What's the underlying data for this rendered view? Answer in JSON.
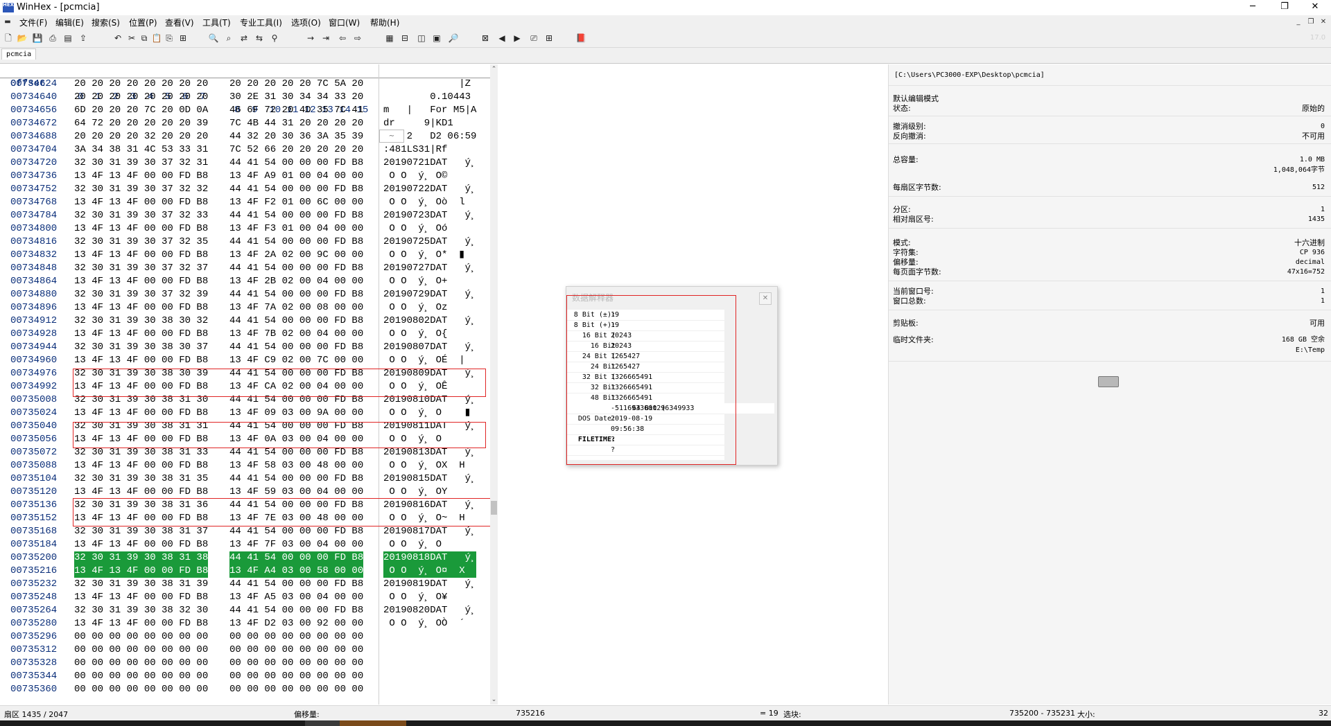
{
  "window": {
    "title": "WinHex - [pcmcia]",
    "app_icon_text": "HEX"
  },
  "menu": [
    "文件(F)",
    "编辑(E)",
    "搜索(S)",
    "位置(P)",
    "查看(V)",
    "工具(T)",
    "专业工具(I)",
    "选项(O)",
    "窗口(W)",
    "帮助(H)"
  ],
  "tab": {
    "label": "pcmcia"
  },
  "hex_header": {
    "offset": "Offset",
    "cols1": "0  1  2  3  4  5  6  7",
    "cols2": "8  9  10 11 12 13 14 15"
  },
  "rows": [
    {
      "off": "00734624",
      "b1": "20 20 20 20 20 20 20 20",
      "b2": "20 20 20 20 20 7C 5A 20",
      "t": "             |Z "
    },
    {
      "off": "00734640",
      "b1": "20 20 20 20 20 20 20 20",
      "b2": "30 2E 31 30 34 34 33 20",
      "t": "        0.10443 "
    },
    {
      "off": "00734656",
      "b1": "6D 20 20 20 7C 20 0D 0A",
      "b2": "46 6F 72 20 4D 35 7C 41",
      "t": "m   |   For M5|A"
    },
    {
      "off": "00734672",
      "b1": "64 72 20 20 20 20 20 39",
      "b2": "7C 4B 44 31 20 20 20 20",
      "t": "dr     9|KD1    "
    },
    {
      "off": "00734688",
      "b1": "20 20 20 20 32 20 20 20",
      "b2": "44 32 20 30 36 3A 35 39",
      "t": "    2   D2 06:59"
    },
    {
      "off": "00734704",
      "b1": "3A 34 38 31 4C 53 33 31",
      "b2": "7C 52 66 20 20 20 20 20",
      "t": ":481LS31|Rf     "
    },
    {
      "off": "00734720",
      "b1": "32 30 31 39 30 37 32 31",
      "b2": "44 41 54 00 00 00 FD B8",
      "t": "20190721DAT   ý¸"
    },
    {
      "off": "00734736",
      "b1": "13 4F 13 4F 00 00 FD B8",
      "b2": "13 4F A9 01 00 04 00 00",
      "t": " O O  ý¸ O©     "
    },
    {
      "off": "00734752",
      "b1": "32 30 31 39 30 37 32 32",
      "b2": "44 41 54 00 00 00 FD B8",
      "t": "20190722DAT   ý¸"
    },
    {
      "off": "00734768",
      "b1": "13 4F 13 4F 00 00 FD B8",
      "b2": "13 4F F2 01 00 6C 00 00",
      "t": " O O  ý¸ Oò  l  "
    },
    {
      "off": "00734784",
      "b1": "32 30 31 39 30 37 32 33",
      "b2": "44 41 54 00 00 00 FD B8",
      "t": "20190723DAT   ý¸"
    },
    {
      "off": "00734800",
      "b1": "13 4F 13 4F 00 00 FD B8",
      "b2": "13 4F F3 01 00 04 00 00",
      "t": " O O  ý¸ Oó     "
    },
    {
      "off": "00734816",
      "b1": "32 30 31 39 30 37 32 35",
      "b2": "44 41 54 00 00 00 FD B8",
      "t": "20190725DAT   ý¸"
    },
    {
      "off": "00734832",
      "b1": "13 4F 13 4F 00 00 FD B8",
      "b2": "13 4F 2A 02 00 9C 00 00",
      "t": " O O  ý¸ O*  ▮  "
    },
    {
      "off": "00734848",
      "b1": "32 30 31 39 30 37 32 37",
      "b2": "44 41 54 00 00 00 FD B8",
      "t": "20190727DAT   ý¸"
    },
    {
      "off": "00734864",
      "b1": "13 4F 13 4F 00 00 FD B8",
      "b2": "13 4F 2B 02 00 04 00 00",
      "t": " O O  ý¸ O+     "
    },
    {
      "off": "00734880",
      "b1": "32 30 31 39 30 37 32 39",
      "b2": "44 41 54 00 00 00 FD B8",
      "t": "20190729DAT   ý¸"
    },
    {
      "off": "00734896",
      "b1": "13 4F 13 4F 00 00 FD B8",
      "b2": "13 4F 7A 02 00 08 00 00",
      "t": " O O  ý¸ Oz     "
    },
    {
      "off": "00734912",
      "b1": "32 30 31 39 30 38 30 32",
      "b2": "44 41 54 00 00 00 FD B8",
      "t": "20190802DAT   ý¸"
    },
    {
      "off": "00734928",
      "b1": "13 4F 13 4F 00 00 FD B8",
      "b2": "13 4F 7B 02 00 04 00 00",
      "t": " O O  ý¸ O{     "
    },
    {
      "off": "00734944",
      "b1": "32 30 31 39 30 38 30 37",
      "b2": "44 41 54 00 00 00 FD B8",
      "t": "20190807DAT   ý¸"
    },
    {
      "off": "00734960",
      "b1": "13 4F 13 4F 00 00 FD B8",
      "b2": "13 4F C9 02 00 7C 00 00",
      "t": " O O  ý¸ OÉ  |  "
    },
    {
      "off": "00734976",
      "b1": "32 30 31 39 30 38 30 39",
      "b2": "44 41 54 00 00 00 FD B8",
      "t": "20190809DAT   ý¸"
    },
    {
      "off": "00734992",
      "b1": "13 4F 13 4F 00 00 FD B8",
      "b2": "13 4F CA 02 00 04 00 00",
      "t": " O O  ý¸ OÊ     "
    },
    {
      "off": "00735008",
      "b1": "32 30 31 39 30 38 31 30",
      "b2": "44 41 54 00 00 00 FD B8",
      "t": "20190810DAT   ý¸"
    },
    {
      "off": "00735024",
      "b1": "13 4F 13 4F 00 00 FD B8",
      "b2": "13 4F 09 03 00 9A 00 00",
      "t": " O O  ý¸ O    ▮  "
    },
    {
      "off": "00735040",
      "b1": "32 30 31 39 30 38 31 31",
      "b2": "44 41 54 00 00 00 FD B8",
      "t": "20190811DAT   ý¸"
    },
    {
      "off": "00735056",
      "b1": "13 4F 13 4F 00 00 FD B8",
      "b2": "13 4F 0A 03 00 04 00 00",
      "t": " O O  ý¸ O      "
    },
    {
      "off": "00735072",
      "b1": "32 30 31 39 30 38 31 33",
      "b2": "44 41 54 00 00 00 FD B8",
      "t": "20190813DAT   ý¸"
    },
    {
      "off": "00735088",
      "b1": "13 4F 13 4F 00 00 FD B8",
      "b2": "13 4F 58 03 00 48 00 00",
      "t": " O O  ý¸ OX  H  "
    },
    {
      "off": "00735104",
      "b1": "32 30 31 39 30 38 31 35",
      "b2": "44 41 54 00 00 00 FD B8",
      "t": "20190815DAT   ý¸"
    },
    {
      "off": "00735120",
      "b1": "13 4F 13 4F 00 00 FD B8",
      "b2": "13 4F 59 03 00 04 00 00",
      "t": " O O  ý¸ OY     "
    },
    {
      "off": "00735136",
      "b1": "32 30 31 39 30 38 31 36",
      "b2": "44 41 54 00 00 00 FD B8",
      "t": "20190816DAT   ý¸"
    },
    {
      "off": "00735152",
      "b1": "13 4F 13 4F 00 00 FD B8",
      "b2": "13 4F 7E 03 00 48 00 00",
      "t": " O O  ý¸ O~  H  "
    },
    {
      "off": "00735168",
      "b1": "32 30 31 39 30 38 31 37",
      "b2": "44 41 54 00 00 00 FD B8",
      "t": "20190817DAT   ý¸"
    },
    {
      "off": "00735184",
      "b1": "13 4F 13 4F 00 00 FD B8",
      "b2": "13 4F 7F 03 00 04 00 00",
      "t": " O O  ý¸ O      "
    },
    {
      "off": "00735200",
      "b1": "32 30 31 39 30 38 31 38",
      "b2": "44 41 54 00 00 00 FD B8",
      "t": "20190818DAT   ý¸"
    },
    {
      "off": "00735216",
      "b1": "13 4F 13 4F 00 00 FD B8",
      "b2": "13 4F A4 03 00 58 00 00",
      "t": " O O  ý¸ O¤  X  "
    },
    {
      "off": "00735232",
      "b1": "32 30 31 39 30 38 31 39",
      "b2": "44 41 54 00 00 00 FD B8",
      "t": "20190819DAT   ý¸"
    },
    {
      "off": "00735248",
      "b1": "13 4F 13 4F 00 00 FD B8",
      "b2": "13 4F A5 03 00 04 00 00",
      "t": " O O  ý¸ O¥     "
    },
    {
      "off": "00735264",
      "b1": "32 30 31 39 30 38 32 30",
      "b2": "44 41 54 00 00 00 FD B8",
      "t": "20190820DAT   ý¸"
    },
    {
      "off": "00735280",
      "b1": "13 4F 13 4F 00 00 FD B8",
      "b2": "13 4F D2 03 00 92 00 00",
      "t": " O O  ý¸ OÒ  ´  "
    },
    {
      "off": "00735296",
      "b1": "00 00 00 00 00 00 00 00",
      "b2": "00 00 00 00 00 00 00 00",
      "t": ""
    },
    {
      "off": "00735312",
      "b1": "00 00 00 00 00 00 00 00",
      "b2": "00 00 00 00 00 00 00 00",
      "t": ""
    },
    {
      "off": "00735328",
      "b1": "00 00 00 00 00 00 00 00",
      "b2": "00 00 00 00 00 00 00 00",
      "t": ""
    },
    {
      "off": "00735344",
      "b1": "00 00 00 00 00 00 00 00",
      "b2": "00 00 00 00 00 00 00 00",
      "t": ""
    },
    {
      "off": "00735360",
      "b1": "00 00 00 00 00 00 00 00",
      "b2": "00 00 00 00 00 00 00 00",
      "t": ""
    }
  ],
  "selected_rows": [
    "00735200",
    "00735216"
  ],
  "data_interpreter": {
    "title": "数据解释器",
    "rows": [
      {
        "label": "8 Bit (±):",
        "value": "19"
      },
      {
        "label": "8 Bit (+):",
        "value": "19"
      },
      {
        "label": "16 Bit (",
        "value": "20243"
      },
      {
        "label": "16 Bit",
        "value": "20243"
      },
      {
        "label": "24 Bit (",
        "value": "1265427"
      },
      {
        "label": "24 Bit",
        "value": "1265427"
      },
      {
        "label": "32 Bit (",
        "value": "1326665491"
      },
      {
        "label": "32 Bit",
        "value": "1326665491"
      },
      {
        "label": "48 Bit",
        "value": "1326665491"
      },
      {
        "label": "64 Bit (",
        "value": "-5116933600296349933"
      },
      {
        "label": "DOS Date:",
        "value": "2019-08-19"
      },
      {
        "label": "",
        "value": "09:56:38"
      },
      {
        "label": "FILETIME:",
        "value": "?"
      },
      {
        "label": "",
        "value": "?"
      }
    ]
  },
  "info": {
    "path": "[C:\\Users\\PC3000-EXP\\Desktop\\pcmcia]",
    "edit_mode": "默认编辑模式",
    "state_label": "状态:",
    "state_value": "原始的",
    "undo_level_label": "撤消级别:",
    "undo_level_value": "0",
    "undo_reverse_label": "反向撤消:",
    "undo_reverse_value": "不可用",
    "capacity_label": "总容量:",
    "capacity_mb": "1.0 MB",
    "capacity_bytes": "1,048,064字节",
    "bytes_per_sector_label": "每扇区字节数:",
    "bytes_per_sector_value": "512",
    "partition_label": "分区:",
    "partition_value": "1",
    "rel_sector_label": "相对扇区号:",
    "rel_sector_value": "1435",
    "mode_label": "模式:",
    "mode_value": "十六进制",
    "charset_label": "字符集:",
    "charset_value": "CP 936",
    "offset_label": "偏移量:",
    "offset_value": "decimal",
    "bytes_per_page_label": "每页面字节数:",
    "bytes_per_page_value": "47x16=752",
    "cur_window_label": "当前窗口号:",
    "cur_window_value": "1",
    "window_total_label": "窗口总数:",
    "window_total_value": "1",
    "clipboard_label": "剪贴板:",
    "clipboard_value": "可用",
    "temp_label": "临时文件夹:",
    "temp_free": "168 GB 空余",
    "temp_path": "E:\\Temp"
  },
  "status": {
    "sector": "扇区 1435 / 2047",
    "offset_label": "偏移量:",
    "offset_value": "735216",
    "eq": "= 19",
    "select_label": "选块:",
    "select_range": "735200 - 735231",
    "size_label": "大小:",
    "size_value": "32"
  },
  "toolbar_right": "17.0"
}
